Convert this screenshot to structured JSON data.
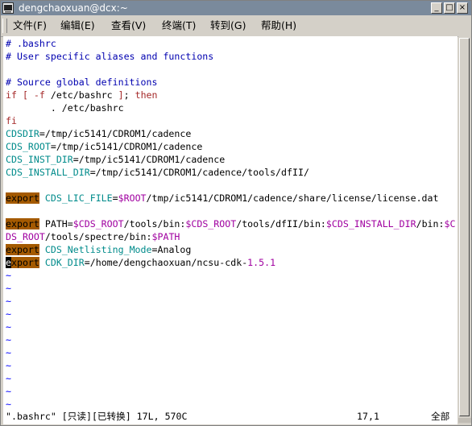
{
  "window": {
    "title": "dengchaoxuan@dcx:~",
    "buttons": {
      "minimize": "_",
      "maximize": "□",
      "close": "×"
    }
  },
  "menu": [
    {
      "label": "文件(F)"
    },
    {
      "label": "编辑(E)"
    },
    {
      "label": "查看(V)"
    },
    {
      "label": "终端(T)"
    },
    {
      "label": "转到(G)"
    },
    {
      "label": "帮助(H)"
    }
  ],
  "colors": {
    "comment": "#0000b0",
    "keyword": "#a52a2a",
    "variable": "#008b8b",
    "string": "#a000a0",
    "export_highlight": "#a45a00",
    "tilde": "#0000ff"
  },
  "editor": {
    "lines": [
      [
        {
          "t": "# .bashrc",
          "c": "comment"
        }
      ],
      [
        {
          "t": "# User specific aliases and functions",
          "c": "comment"
        }
      ],
      [],
      [
        {
          "t": "# Source global definitions",
          "c": "comment"
        }
      ],
      [
        {
          "t": "if",
          "c": "kw"
        },
        {
          "t": " "
        },
        {
          "t": "[",
          "c": "kw"
        },
        {
          "t": " "
        },
        {
          "t": "-f",
          "c": "kw"
        },
        {
          "t": " /etc/bashrc "
        },
        {
          "t": "]",
          "c": "kw"
        },
        {
          "t": "; "
        },
        {
          "t": "then",
          "c": "kw"
        }
      ],
      [
        {
          "t": "        . /etc/bashrc"
        }
      ],
      [
        {
          "t": "fi",
          "c": "kw"
        }
      ],
      [
        {
          "t": "CDSDIR",
          "c": "var"
        },
        {
          "t": "=/tmp/ic5141/CDROM1/cadence"
        }
      ],
      [
        {
          "t": "CDS_ROOT",
          "c": "var"
        },
        {
          "t": "=/tmp/ic5141/CDROM1/cadence"
        }
      ],
      [
        {
          "t": "CDS_INST_DIR",
          "c": "var"
        },
        {
          "t": "=/tmp/ic5141/CDROM1/cadence"
        }
      ],
      [
        {
          "t": "CDS_INSTALL_DIR",
          "c": "var"
        },
        {
          "t": "=/tmp/ic5141/CDROM1/cadence/tools/dfII/"
        }
      ],
      [],
      [
        {
          "t": "export",
          "c": "exp"
        },
        {
          "t": " "
        },
        {
          "t": "CDS_LIC_FILE",
          "c": "var"
        },
        {
          "t": "="
        },
        {
          "t": "$ROOT",
          "c": "str"
        },
        {
          "t": "/tmp/ic5141/CDROM1/cadence/share/license/license.dat"
        }
      ],
      [],
      [
        {
          "t": "export",
          "c": "exp"
        },
        {
          "t": " PATH="
        },
        {
          "t": "$CDS_ROOT",
          "c": "str"
        },
        {
          "t": "/tools/bin:"
        },
        {
          "t": "$CDS_ROOT",
          "c": "str"
        },
        {
          "t": "/tools/dfII/bin:"
        },
        {
          "t": "$CDS_INSTALL_DIR",
          "c": "str"
        },
        {
          "t": "/bin:"
        },
        {
          "t": "$C",
          "c": "str"
        }
      ],
      [
        {
          "t": "DS_ROOT",
          "c": "str"
        },
        {
          "t": "/tools/spectre/bin:"
        },
        {
          "t": "$PATH",
          "c": "str"
        }
      ],
      [
        {
          "t": "export",
          "c": "exp"
        },
        {
          "t": " "
        },
        {
          "t": "CDS_Netlisting_Mode",
          "c": "var"
        },
        {
          "t": "=Analog"
        }
      ],
      [
        {
          "t": "e",
          "c": "cursor"
        },
        {
          "t": "xport",
          "c": "exp"
        },
        {
          "t": " "
        },
        {
          "t": "CDK_DIR",
          "c": "var"
        },
        {
          "t": "=/home/dengchaoxuan/ncsu-cdk-"
        },
        {
          "t": "1.5.1",
          "c": "str"
        }
      ],
      [
        {
          "t": "~",
          "c": "tilde"
        }
      ],
      [
        {
          "t": "~",
          "c": "tilde"
        }
      ],
      [
        {
          "t": "~",
          "c": "tilde"
        }
      ],
      [
        {
          "t": "~",
          "c": "tilde"
        }
      ],
      [
        {
          "t": "~",
          "c": "tilde"
        }
      ],
      [
        {
          "t": "~",
          "c": "tilde"
        }
      ],
      [
        {
          "t": "~",
          "c": "tilde"
        }
      ],
      [
        {
          "t": "~",
          "c": "tilde"
        }
      ],
      [
        {
          "t": "~",
          "c": "tilde"
        }
      ],
      [
        {
          "t": "~",
          "c": "tilde"
        }
      ],
      [
        {
          "t": "~",
          "c": "tilde"
        }
      ]
    ]
  },
  "status": {
    "file": "\".bashrc\" [只读][已转换] 17L, 570C",
    "position": "17,1",
    "scroll": "全部"
  }
}
